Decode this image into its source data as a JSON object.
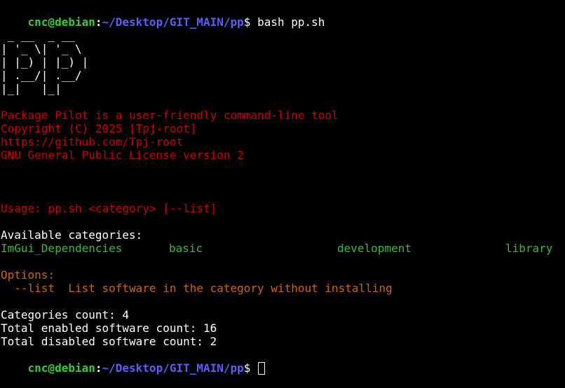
{
  "colors": {
    "background": "#000000",
    "prompt_user": "#33cc33",
    "prompt_path": "#5c5cff",
    "text": "#ffffff",
    "info": "#cc0000",
    "categories": "#33bb33",
    "options": "#cc6600"
  },
  "prompt": {
    "user_host": "cnc@debian",
    "sep": ":",
    "path": "~/Desktop/GIT_MAIN/pp",
    "symbol": "$",
    "command": " bash pp.sh"
  },
  "logo": [
    " _ __  _ __",
    "| '_ \\| '_ \\",
    "| |_) | |_) |",
    "| .__/| .__/",
    "|_|   |_|"
  ],
  "info": [
    "Package Pilot is a user-friendly command-line tool",
    "Copyright (C) 2025 [Tpj-root]",
    "https://github.com/Tpj-root",
    "GNU General Public License version 2"
  ],
  "usage": "Usage: pp.sh <category> [--list]",
  "categories_header": "Available categories:",
  "categories": [
    "ImGui_Dependencies",
    "basic",
    "development",
    "library"
  ],
  "options_header": "Options:",
  "options_line": "  --list  List software in the category without installing",
  "stats": [
    "Categories count: 4",
    "Total enabled software count: 16",
    "Total disabled software count: 2"
  ]
}
